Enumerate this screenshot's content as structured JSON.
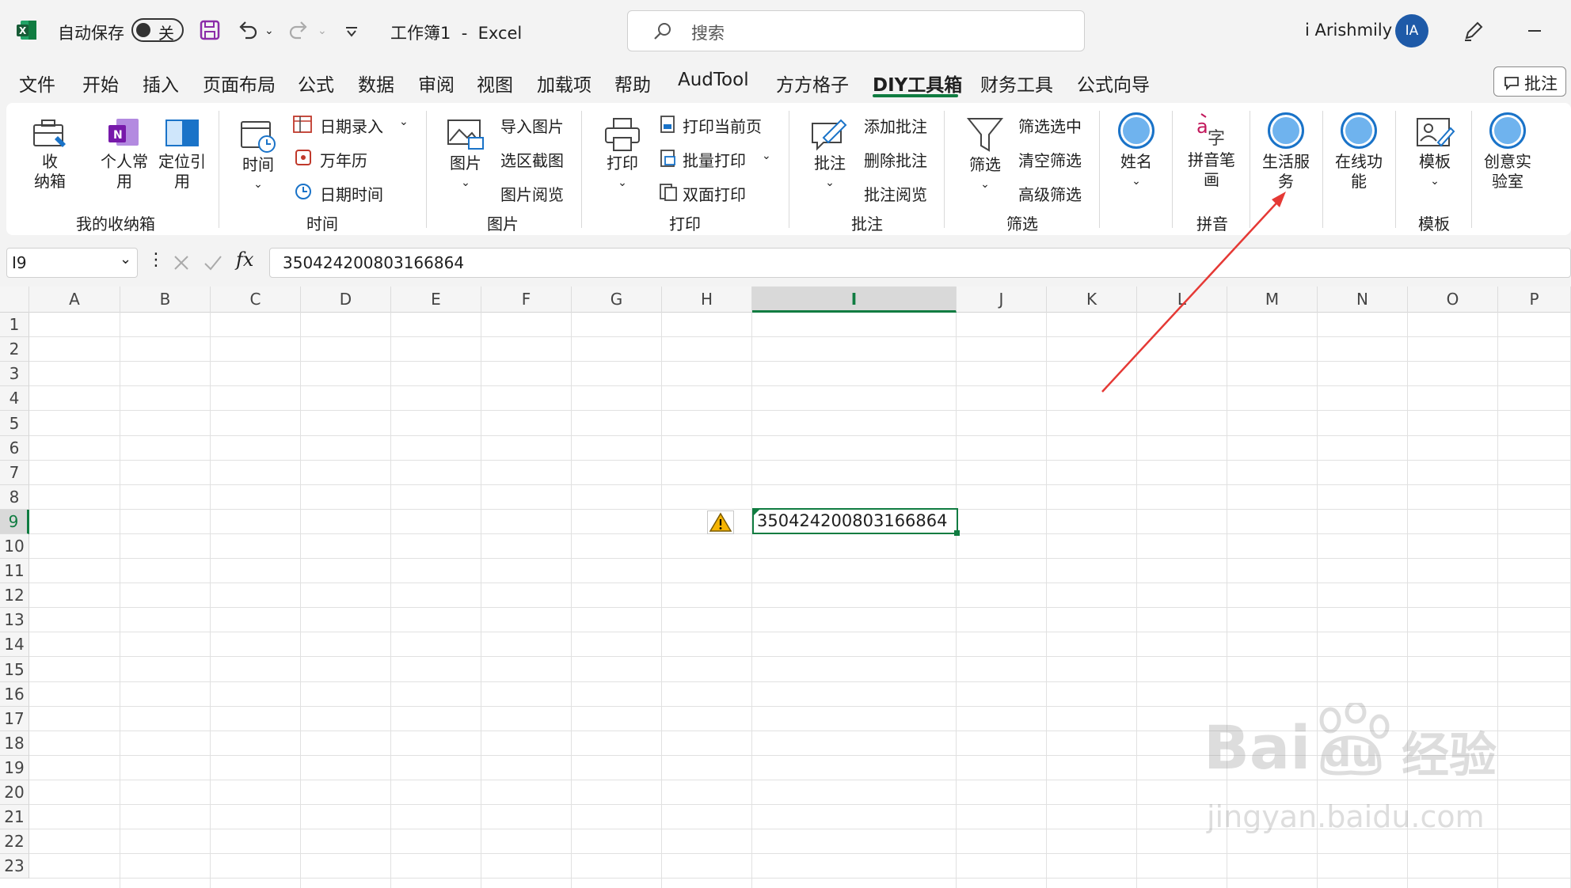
{
  "titlebar": {
    "autosave_label": "自动保存",
    "autosave_state": "关",
    "document_title": "工作簿1  -  Excel",
    "search_placeholder": "搜索",
    "user_name": "i Arishmily",
    "avatar_initials": "IA"
  },
  "menu": {
    "tabs": [
      "文件",
      "开始",
      "插入",
      "页面布局",
      "公式",
      "数据",
      "审阅",
      "视图",
      "加载项",
      "帮助",
      "AudTool",
      "方方格子",
      "DIY工具箱",
      "财务工具",
      "公式向导"
    ],
    "active_tab": "DIY工具箱",
    "comment_button": "批注"
  },
  "ribbon": {
    "storage": {
      "btn1": "收\n纳箱",
      "btn2": "个人常\n用",
      "btn3": "定位引\n用",
      "group": "我的收纳箱"
    },
    "time": {
      "big": "时间",
      "item1": "日期录入",
      "item2": "万年历",
      "item3": "日期时间",
      "group": "时间"
    },
    "picture": {
      "big": "图片",
      "item1": "导入图片",
      "item2": "选区截图",
      "item3": "图片阅览",
      "group": "图片"
    },
    "print": {
      "big": "打印",
      "item1": "打印当前页",
      "item2": "批量打印",
      "item3": "双面打印",
      "group": "打印"
    },
    "comment": {
      "big": "批注",
      "item1": "添加批注",
      "item2": "删除批注",
      "item3": "批注阅览",
      "group": "批注"
    },
    "filter": {
      "big": "筛选",
      "item1": "筛选选中",
      "item2": "清空筛选",
      "item3": "高级筛选",
      "group": "筛选"
    },
    "name": {
      "big": "姓名"
    },
    "pinyin": {
      "big": "拼音笔\n画",
      "group": "拼音"
    },
    "life": {
      "big": "生活服\n务"
    },
    "online": {
      "big": "在线功\n能"
    },
    "template": {
      "big": "模板",
      "group": "模板"
    },
    "lab": {
      "big": "创意实\n验室"
    }
  },
  "formula_bar": {
    "cell_ref": "I9",
    "fx": "fx",
    "value": "350424200803166864"
  },
  "grid": {
    "columns": [
      "A",
      "B",
      "C",
      "D",
      "E",
      "F",
      "G",
      "H",
      "I",
      "J",
      "K",
      "L",
      "M",
      "N",
      "O",
      "P"
    ],
    "selected_column": "I",
    "rows": [
      "1",
      "2",
      "3",
      "4",
      "5",
      "6",
      "7",
      "8",
      "9",
      "10",
      "11",
      "12",
      "13",
      "14",
      "15",
      "16",
      "17",
      "18",
      "19",
      "20",
      "21",
      "22",
      "23"
    ],
    "selected_row": "9",
    "active_cell_value": "350424200803166864"
  },
  "watermark": {
    "text1": "Bai",
    "text2": "du",
    "text3": "经验",
    "text4": "jingyan.baidu.com"
  },
  "colors": {
    "excel_green": "#107c41",
    "arrow_red": "#e53935",
    "accent_blue": "#1a73c8"
  }
}
